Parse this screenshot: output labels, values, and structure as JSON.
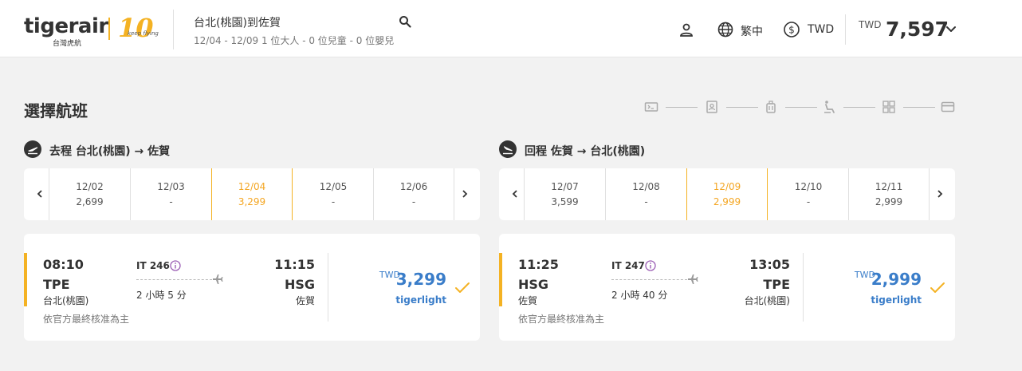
{
  "header": {
    "logo_text": "tigerair",
    "logo_sub": "台灣虎航",
    "logo_badge": "10",
    "logo_tag": "keep flying",
    "search_title": "台北(桃園)到佐賀",
    "search_summary": "12/04 - 12/09   1 位大人 - 0 位兒童 - 0 位嬰兒",
    "language": "繁中",
    "currency": "TWD",
    "total_currency": "TWD",
    "total_amount": "7,597",
    "icons": [
      "search-icon",
      "user-icon",
      "globe-icon",
      "dollar-icon",
      "chevron-down-icon"
    ]
  },
  "page": {
    "title": "選擇航班",
    "steps": [
      "boarding-pass-icon",
      "passenger-icon",
      "luggage-icon",
      "seat-icon",
      "services-icon",
      "payment-icon"
    ]
  },
  "outbound": {
    "label": "去程  台北(桃園) → 佐賀",
    "dates": [
      {
        "date": "12/02",
        "price": "2,699",
        "selected": false
      },
      {
        "date": "12/03",
        "price": "-",
        "selected": false
      },
      {
        "date": "12/04",
        "price": "3,299",
        "selected": true
      },
      {
        "date": "12/05",
        "price": "-",
        "selected": false
      },
      {
        "date": "12/06",
        "price": "-",
        "selected": false
      }
    ],
    "flight": {
      "dep_time": "08:10",
      "dep_code": "TPE",
      "dep_name": "台北(桃園)",
      "flight_no": "IT 246",
      "duration": "2 小時 5 分",
      "arr_time": "11:15",
      "arr_code": "HSG",
      "arr_name": "佐賀",
      "note": "依官方最終核准為主",
      "fare_currency": "TWD",
      "fare_amount": "3,299",
      "fare_type": "tigerlight"
    }
  },
  "inbound": {
    "label": "回程  佐賀 → 台北(桃園)",
    "dates": [
      {
        "date": "12/07",
        "price": "3,599",
        "selected": false
      },
      {
        "date": "12/08",
        "price": "-",
        "selected": false
      },
      {
        "date": "12/09",
        "price": "2,999",
        "selected": true
      },
      {
        "date": "12/10",
        "price": "-",
        "selected": false
      },
      {
        "date": "12/11",
        "price": "2,999",
        "selected": false
      }
    ],
    "flight": {
      "dep_time": "11:25",
      "dep_code": "HSG",
      "dep_name": "佐賀",
      "flight_no": "IT 247",
      "duration": "2 小時 40 分",
      "arr_time": "13:05",
      "arr_code": "TPE",
      "arr_name": "台北(桃園)",
      "note": "依官方最終核准為主",
      "fare_currency": "TWD",
      "fare_amount": "2,999",
      "fare_type": "tigerlight"
    }
  },
  "colors": {
    "accent": "#f4b223",
    "selected_date": "#f4a623",
    "fare": "#3a7dc9",
    "background": "#f2f2f2"
  }
}
